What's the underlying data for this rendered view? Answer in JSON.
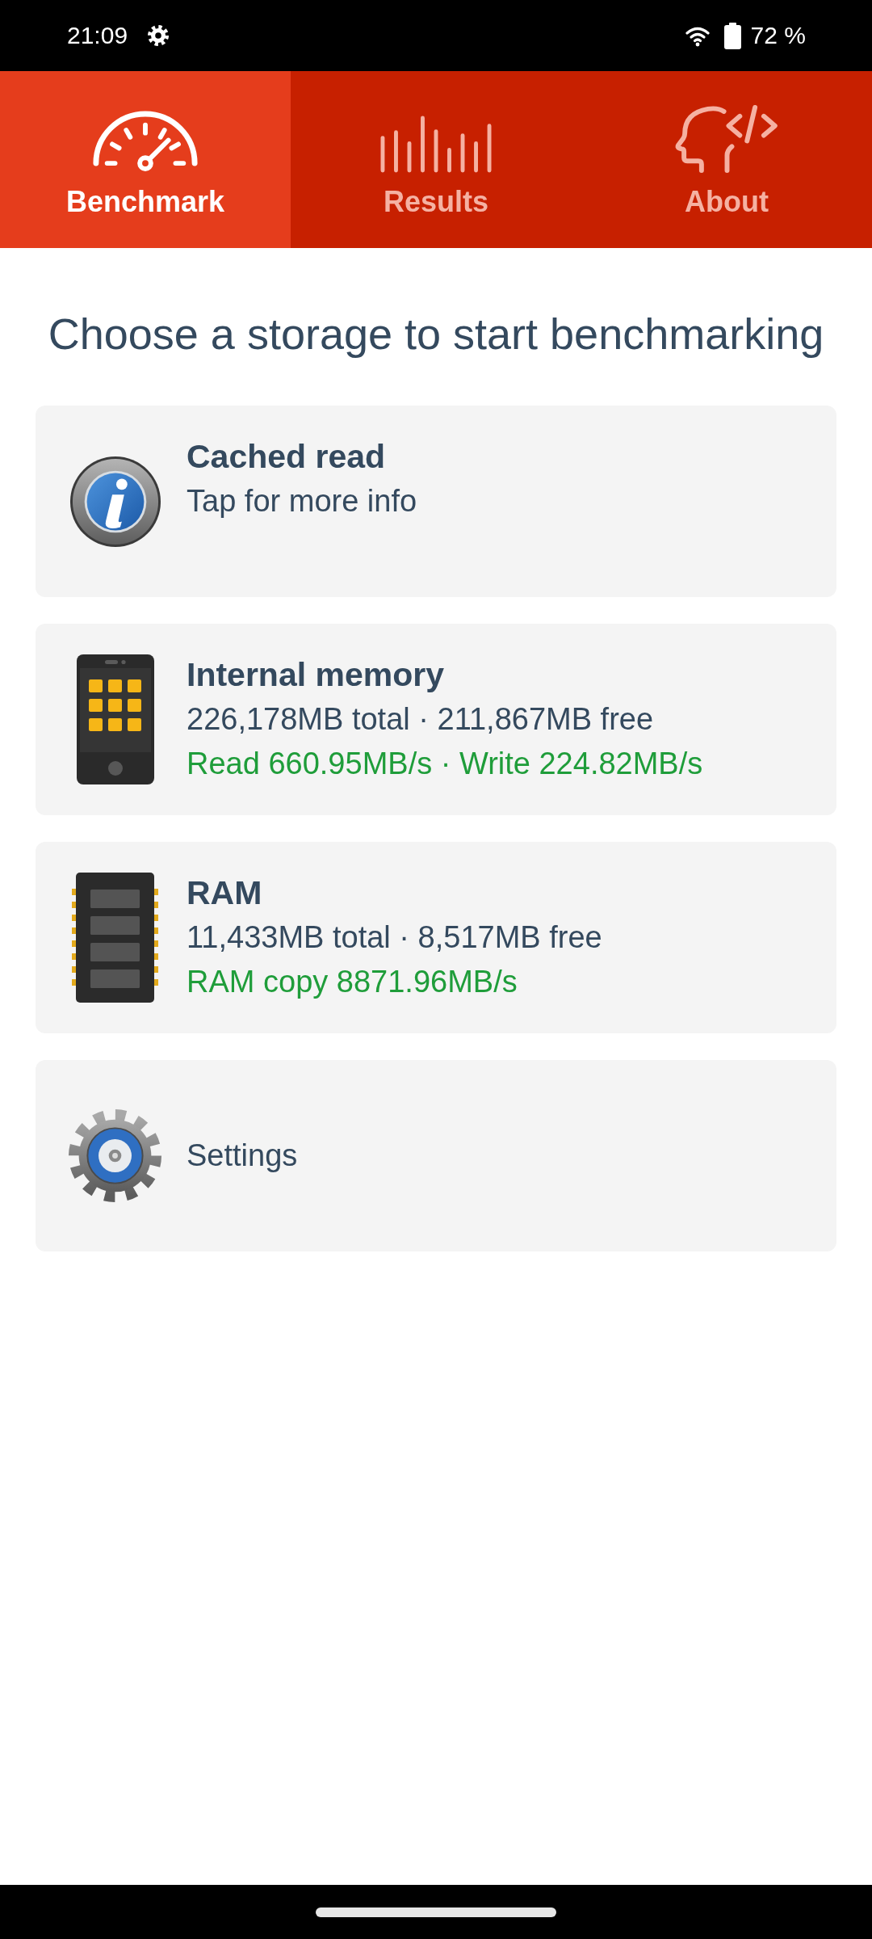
{
  "status_bar": {
    "time": "21:09",
    "battery_text": "72 %"
  },
  "tabs": [
    {
      "label": "Benchmark",
      "selected": true,
      "kind": "gauge"
    },
    {
      "label": "Results",
      "selected": false,
      "kind": "bars"
    },
    {
      "label": "About",
      "selected": false,
      "kind": "head"
    }
  ],
  "heading": "Choose a storage to start benchmarking",
  "items": [
    {
      "kind": "info",
      "title": "Cached read",
      "subtitle": "Tap for more info"
    },
    {
      "kind": "phone",
      "title": "Internal memory",
      "subtitle": "226,178MB total · 211,867MB free",
      "speed": "Read 660.95MB/s · Write 224.82MB/s"
    },
    {
      "kind": "chip",
      "title": "RAM",
      "subtitle": "11,433MB total · 8,517MB free",
      "speed": "RAM copy 8871.96MB/s"
    },
    {
      "kind": "settings",
      "label": "Settings"
    }
  ]
}
